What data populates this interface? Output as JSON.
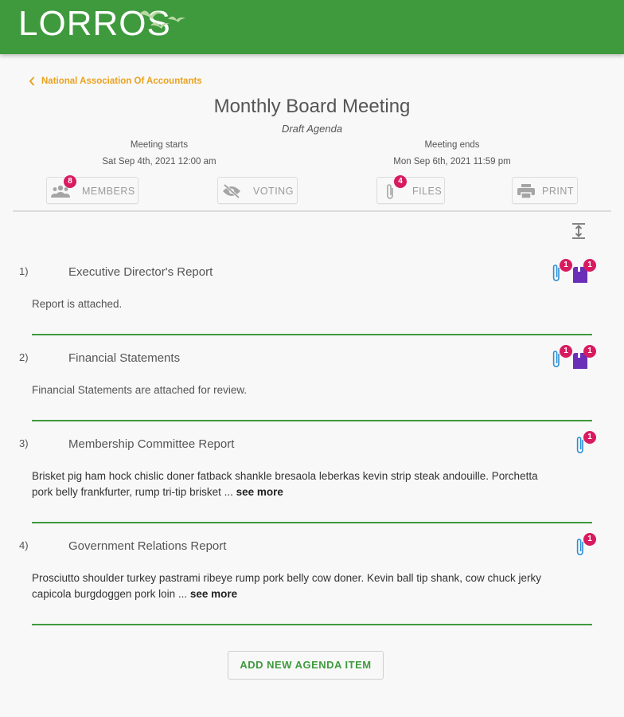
{
  "app": {
    "logo_text": "LORROS"
  },
  "breadcrumb": {
    "back_label": "National Association Of Accountants"
  },
  "meeting": {
    "title": "Monthly Board Meeting",
    "subtitle": "Draft Agenda",
    "starts_label": "Meeting starts",
    "starts_value": "Sat Sep 4th, 2021 12:00 am",
    "ends_label": "Meeting ends",
    "ends_value": "Mon Sep 6th, 2021 11:59 pm"
  },
  "toolbar": {
    "members": {
      "label": "MEMBERS",
      "badge": "8",
      "icon": "people-icon"
    },
    "voting": {
      "label": "VOTING",
      "icon": "eye-off-icon"
    },
    "files": {
      "label": "FILES",
      "badge": "4",
      "icon": "paperclip-icon"
    },
    "print": {
      "label": "PRINT",
      "icon": "printer-icon"
    }
  },
  "agenda": [
    {
      "number": "1)",
      "title": "Executive Director's Report",
      "description": "Report is attached.",
      "see_more": "",
      "attachments": "1",
      "notes": "1"
    },
    {
      "number": "2)",
      "title": "Financial Statements",
      "description": "Financial Statements are attached for review.",
      "see_more": "",
      "attachments": "1",
      "notes": "1"
    },
    {
      "number": "3)",
      "title": "Membership Committee Report",
      "description_line1": "Brisket pig ham hock chislic doner fatback shankle bresaola leberkas kevin strip steak andouille. Porchetta",
      "description_line2": "pork belly frankfurter, rump tri-tip brisket ... ",
      "see_more": "see more",
      "attachments": "1"
    },
    {
      "number": "4)",
      "title": "Government Relations Report",
      "description_line1": "Prosciutto shoulder turkey pastrami ribeye rump pork belly cow doner. Kevin ball tip shank, cow chuck jerky",
      "description_line2": "capicola burgdoggen pork loin ... ",
      "see_more": "see more",
      "attachments": "1"
    }
  ],
  "actions": {
    "add_item_label": "ADD NEW AGENDA ITEM"
  },
  "colors": {
    "brand_green": "#3f9a3e",
    "accent_orange": "#e9a21f",
    "badge_pink": "#d81b60",
    "note_purple": "#6a2fb8",
    "clip_blue": "#2b8fd6"
  }
}
